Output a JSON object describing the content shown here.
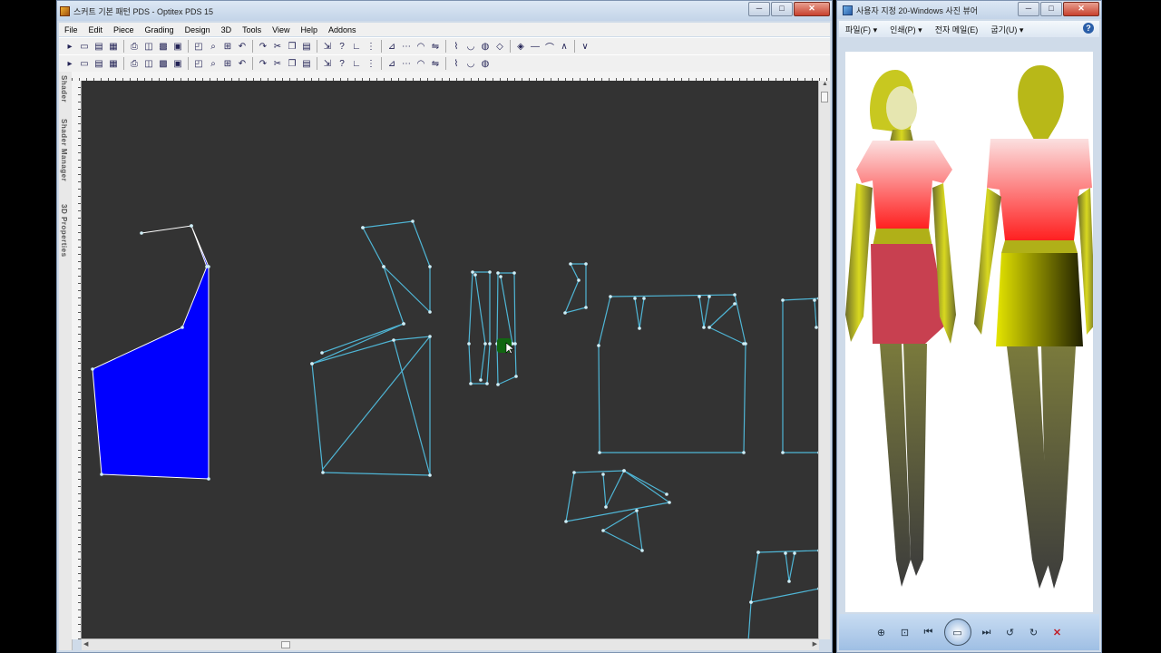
{
  "pds_window": {
    "title": "스커트 기본 패턴 PDS - Optitex PDS 15",
    "caption_buttons": {
      "minimize": "─",
      "maximize": "□",
      "close": "✕"
    },
    "menu": [
      "File",
      "Edit",
      "Piece",
      "Grading",
      "Design",
      "3D",
      "Tools",
      "View",
      "Help",
      "Addons"
    ],
    "side_tabs": [
      "Shader",
      "Shader Manager",
      "3D Properties"
    ],
    "toolbar1_icons": [
      "select-arrow-icon",
      "new-file-icon",
      "open-file-icon",
      "save-icon",
      "print-icon",
      "printer-setup-icon",
      "plot-icon",
      "excel-icon",
      "snapshot-icon",
      "zoom-icon",
      "zoom-window-icon",
      "undo-icon",
      "redo-icon",
      "cut-icon",
      "copy-icon",
      "paste-icon",
      "import-icon",
      "help-icon",
      "measure-icon",
      "grade-icon",
      "rule-icon",
      "seam-icon",
      "notch-icon",
      "mirror-icon",
      "stitch-icon",
      "sew-icon",
      "3d-icon",
      "drape-icon",
      "cloth-icon",
      "line-icon",
      "pleat-icon",
      "dart-icon",
      "tuck-icon"
    ],
    "toolbar2_icons": [
      "point-icon",
      "add-point-icon",
      "curve-icon",
      "pen-icon",
      "circle-icon",
      "globe-icon",
      "text-icon",
      "measure-tape-icon",
      "lasso-icon",
      "wave-icon",
      "cut-line-icon",
      "trash-icon",
      "pin-icon",
      "move-icon",
      "rotate-icon",
      "scale-icon",
      "copy-piece-icon",
      "refresh-icon",
      "rotate-ccw-icon",
      "rotate-cw-icon",
      "flip-icon",
      "align-icon",
      "layer-icon",
      "report-icon",
      "settings-icon",
      "export-icon",
      "pattern-icon"
    ],
    "accent_piece_color": "#0000ff",
    "outline_color": "#4fb6d6",
    "canvas_color": "#333333"
  },
  "viewer_window": {
    "title": "사용자 지정 20-Windows 사진 뷰어",
    "caption_buttons": {
      "minimize": "─",
      "maximize": "□",
      "close": "✕"
    },
    "menu": [
      "파일(F)",
      "인쇄(P)",
      "전자 메일(E)",
      "굽기(U)"
    ],
    "help": "?",
    "controls": [
      "zoom-icon",
      "fit-icon",
      "previous-icon",
      "slideshow-icon",
      "next-icon",
      "rotate-ccw-icon",
      "rotate-cw-icon",
      "delete-icon"
    ],
    "control_glyphs": [
      "⊕",
      "⊡",
      "⏮",
      "▭",
      "⏭",
      "↺",
      "↻",
      "✕"
    ]
  }
}
